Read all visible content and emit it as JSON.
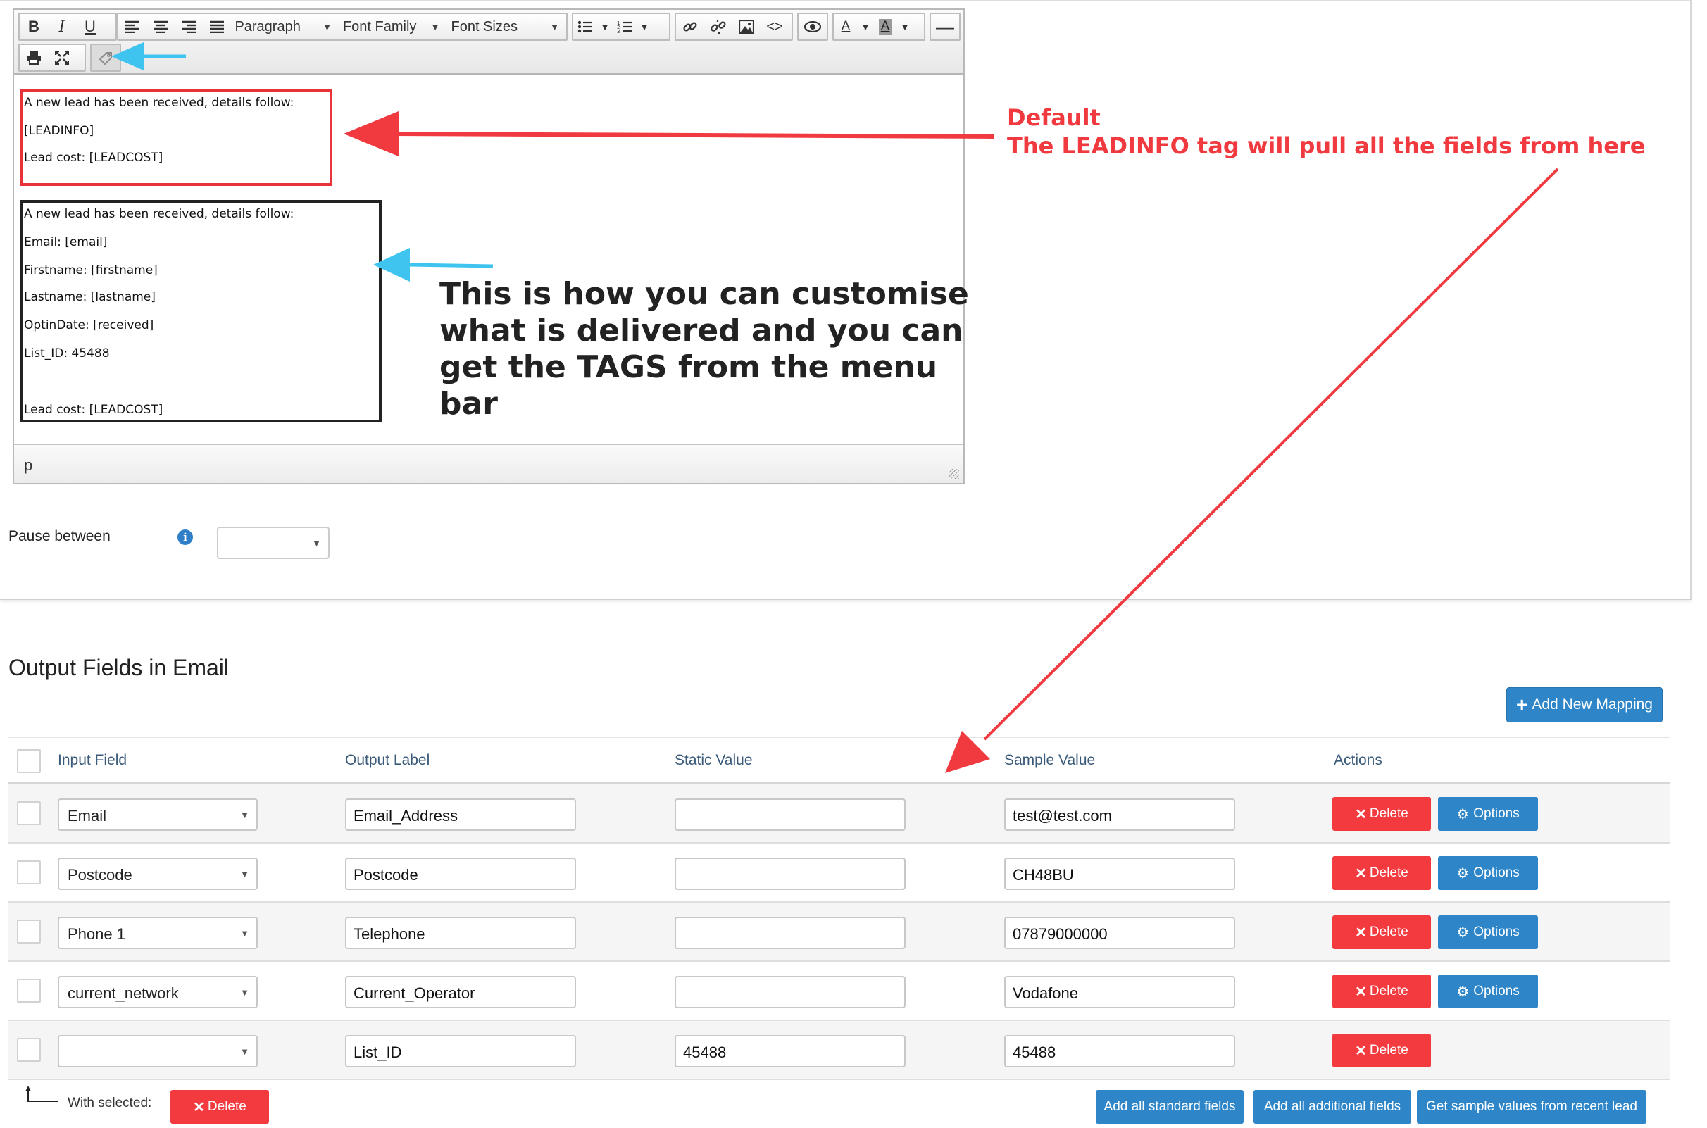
{
  "toolbar": {
    "bold": "B",
    "italic": "I",
    "underline": "U",
    "paragraph": "Paragraph",
    "font_family": "Font Family",
    "font_sizes": "Font Sizes",
    "code": "<>",
    "text_color": "A",
    "bg_color": "A",
    "hr": "—",
    "icons": [
      "bold-icon",
      "italic-icon",
      "underline-icon",
      "align-left-icon",
      "align-center-icon",
      "align-right-icon",
      "justify-icon",
      "bullet-list-icon",
      "numbered-list-icon",
      "link-icon",
      "unlink-icon",
      "image-icon",
      "code-icon",
      "preview-icon",
      "text-color-icon",
      "background-color-icon",
      "horizontal-rule-icon",
      "print-icon",
      "fullscreen-icon",
      "tag-icon"
    ]
  },
  "editor": {
    "default_block": {
      "line1": "A new lead has been received, details follow:",
      "line2": "[LEADINFO]",
      "line3": "Lead cost: [LEADCOST]"
    },
    "custom_block": {
      "line1": "A new lead has been received, details follow:",
      "line2": "Email: [email]",
      "line3": "Firstname: [firstname]",
      "line4": "Lastname: [lastname]",
      "line5": "OptinDate: [received]",
      "line6": "List_ID: 45488",
      "line7": "Lead cost: [LEADCOST]"
    },
    "status_path": "p"
  },
  "annotations": {
    "default_title": "Default",
    "default_desc": "The LEADINFO tag will pull all the fields from here",
    "custom_line1": "This is how you can customise",
    "custom_line2": "what is delivered and you can",
    "custom_line3": "get the TAGS from the menu bar",
    "red_color": "#f03a3f",
    "cyan_color": "#3fc4ef"
  },
  "pause": {
    "label": "Pause between",
    "value": ""
  },
  "output": {
    "title": "Output Fields in Email",
    "add_mapping": "Add New Mapping",
    "headers": {
      "input": "Input Field",
      "label": "Output Label",
      "static": "Static Value",
      "sample": "Sample Value",
      "actions": "Actions"
    },
    "rows": [
      {
        "input": "Email",
        "label": "Email_Address",
        "static": "",
        "sample": "test@test.com",
        "delete": "Delete",
        "options": "Options"
      },
      {
        "input": "Postcode",
        "label": "Postcode",
        "static": "",
        "sample": "CH48BU",
        "delete": "Delete",
        "options": "Options"
      },
      {
        "input": "Phone 1",
        "label": "Telephone",
        "static": "",
        "sample": "07879000000",
        "delete": "Delete",
        "options": "Options"
      },
      {
        "input": "current_network",
        "label": "Current_Operator",
        "static": "",
        "sample": "Vodafone",
        "delete": "Delete",
        "options": "Options"
      },
      {
        "input": "",
        "label": "List_ID",
        "static": "45488",
        "sample": "45488",
        "delete": "Delete",
        "options": ""
      }
    ],
    "with_selected": "With selected:",
    "delete_selected": "Delete",
    "add_standard": "Add all standard fields",
    "add_additional": "Add all additional fields",
    "get_sample": "Get sample values from recent lead"
  },
  "colors": {
    "primary": "#2e86c9",
    "danger": "#f23a3f"
  }
}
